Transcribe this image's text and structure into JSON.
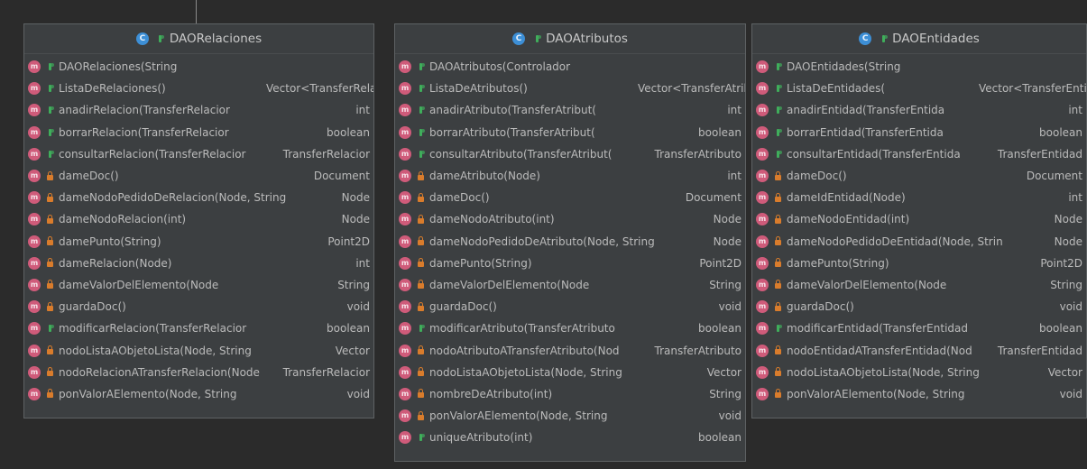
{
  "colors": {
    "background": "#2b2b2b",
    "box": "#3c3f41",
    "border": "#5e6264",
    "class_icon": "#3d8fd6",
    "method_icon": "#cf5b7a",
    "public": "#3fae5b",
    "private": "#d97c2c"
  },
  "class_icon_letter": "C",
  "method_icon_letter": "m",
  "classes": [
    {
      "name": "DAORelaciones",
      "methods": [
        {
          "sig": "DAORelaciones(String",
          "ret": "",
          "vis": "public"
        },
        {
          "sig": "ListaDeRelaciones()",
          "ret": "Vector<TransferRelacion:",
          "vis": "public"
        },
        {
          "sig": "anadirRelacion(TransferRelacior",
          "ret": "int",
          "vis": "public"
        },
        {
          "sig": "borrarRelacion(TransferRelacior",
          "ret": "boolean",
          "vis": "public"
        },
        {
          "sig": "consultarRelacion(TransferRelacior",
          "ret": "TransferRelacior",
          "vis": "public"
        },
        {
          "sig": "dameDoc()",
          "ret": "Document",
          "vis": "private"
        },
        {
          "sig": "dameNodoPedidoDeRelacion(Node, String",
          "ret": "Node",
          "vis": "private"
        },
        {
          "sig": "dameNodoRelacion(int)",
          "ret": "Node",
          "vis": "private"
        },
        {
          "sig": "damePunto(String)",
          "ret": "Point2D",
          "vis": "private"
        },
        {
          "sig": "dameRelacion(Node)",
          "ret": "int",
          "vis": "private"
        },
        {
          "sig": "dameValorDelElemento(Node",
          "ret": "String",
          "vis": "private"
        },
        {
          "sig": "guardaDoc()",
          "ret": "void",
          "vis": "private"
        },
        {
          "sig": "modificarRelacion(TransferRelacior",
          "ret": "boolean",
          "vis": "public"
        },
        {
          "sig": "nodoListaAObjetoLista(Node, String",
          "ret": "Vector",
          "vis": "private"
        },
        {
          "sig": "nodoRelacionATransferRelacion(Node",
          "ret": "TransferRelacior",
          "vis": "private"
        },
        {
          "sig": "ponValorAElemento(Node, String",
          "ret": "void",
          "vis": "private"
        }
      ]
    },
    {
      "name": "DAOAtributos",
      "methods": [
        {
          "sig": "DAOAtributos(Controlador",
          "ret": "",
          "vis": "public"
        },
        {
          "sig": "ListaDeAtributos()",
          "ret": "Vector<TransferAtributo:",
          "vis": "public"
        },
        {
          "sig": "anadirAtributo(TransferAtribut(",
          "ret": "int",
          "vis": "public"
        },
        {
          "sig": "borrarAtributo(TransferAtribut(",
          "ret": "boolean",
          "vis": "public"
        },
        {
          "sig": "consultarAtributo(TransferAtribut(",
          "ret": "TransferAtributo",
          "vis": "public"
        },
        {
          "sig": "dameAtributo(Node)",
          "ret": "int",
          "vis": "private"
        },
        {
          "sig": "dameDoc()",
          "ret": "Document",
          "vis": "private"
        },
        {
          "sig": "dameNodoAtributo(int)",
          "ret": "Node",
          "vis": "private"
        },
        {
          "sig": "dameNodoPedidoDeAtributo(Node, String",
          "ret": "Node",
          "vis": "private"
        },
        {
          "sig": "damePunto(String)",
          "ret": "Point2D",
          "vis": "private"
        },
        {
          "sig": "dameValorDelElemento(Node",
          "ret": "String",
          "vis": "private"
        },
        {
          "sig": "guardaDoc()",
          "ret": "void",
          "vis": "private"
        },
        {
          "sig": "modificarAtributo(TransferAtributo",
          "ret": "boolean",
          "vis": "public"
        },
        {
          "sig": "nodoAtributoATransferAtributo(Nod",
          "ret": "TransferAtributo",
          "vis": "private"
        },
        {
          "sig": "nodoListaAObjetoLista(Node, String",
          "ret": "Vector",
          "vis": "private"
        },
        {
          "sig": "nombreDeAtributo(int)",
          "ret": "String",
          "vis": "private"
        },
        {
          "sig": "ponValorAElemento(Node, String",
          "ret": "void",
          "vis": "private"
        },
        {
          "sig": "uniqueAtributo(int)",
          "ret": "boolean",
          "vis": "public"
        }
      ]
    },
    {
      "name": "DAOEntidades",
      "methods": [
        {
          "sig": "DAOEntidades(String",
          "ret": "",
          "vis": "public"
        },
        {
          "sig": "ListaDeEntidades(",
          "ret": "Vector<TransferEntidad",
          "vis": "public"
        },
        {
          "sig": "anadirEntidad(TransferEntida",
          "ret": "int",
          "vis": "public"
        },
        {
          "sig": "borrarEntidad(TransferEntida",
          "ret": "boolean",
          "vis": "public"
        },
        {
          "sig": "consultarEntidad(TransferEntida",
          "ret": "TransferEntidad",
          "vis": "public"
        },
        {
          "sig": "dameDoc()",
          "ret": "Document",
          "vis": "private"
        },
        {
          "sig": "dameIdEntidad(Node)",
          "ret": "int",
          "vis": "private"
        },
        {
          "sig": "dameNodoEntidad(int)",
          "ret": "Node",
          "vis": "private"
        },
        {
          "sig": "dameNodoPedidoDeEntidad(Node, Strin",
          "ret": "Node",
          "vis": "private"
        },
        {
          "sig": "damePunto(String)",
          "ret": "Point2D",
          "vis": "private"
        },
        {
          "sig": "dameValorDelElemento(Node",
          "ret": "String",
          "vis": "private"
        },
        {
          "sig": "guardaDoc()",
          "ret": "void",
          "vis": "private"
        },
        {
          "sig": "modificarEntidad(TransferEntidad",
          "ret": "boolean",
          "vis": "public"
        },
        {
          "sig": "nodoEntidadATransferEntidad(Nod",
          "ret": "TransferEntidad",
          "vis": "private"
        },
        {
          "sig": "nodoListaAObjetoLista(Node, String",
          "ret": "Vector",
          "vis": "private"
        },
        {
          "sig": "ponValorAElemento(Node, String",
          "ret": "void",
          "vis": "private"
        }
      ]
    }
  ]
}
